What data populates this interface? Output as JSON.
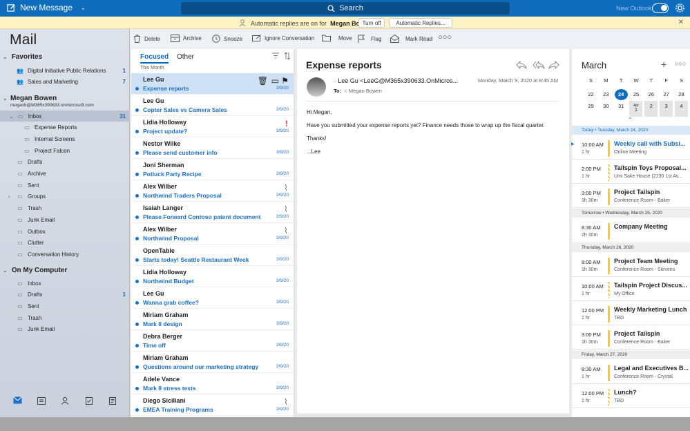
{
  "topbar": {
    "new_message": "New Message",
    "search": "Search",
    "new_outlook": "New Outlook"
  },
  "banner": {
    "text": "Automatic replies are on for",
    "user": "Megan Bowen.",
    "turn_off": "Turn off",
    "auto_replies": "Automatic Replies..."
  },
  "sidebar": {
    "title": "Mail",
    "favorites_label": "Favorites",
    "favorites": [
      {
        "label": "Digital Initiative Public Relations",
        "count": "1"
      },
      {
        "label": "Sales and Marketing",
        "count": "7"
      }
    ],
    "account_name": "Megan Bowen",
    "account_email": "meganb@M365x390633.onmicrosoft.com",
    "folders": [
      {
        "label": "Inbox",
        "count": "31"
      },
      {
        "label": "Expense Reports",
        "count": ""
      },
      {
        "label": "Internal Screens",
        "count": ""
      },
      {
        "label": "Project Falcon",
        "count": ""
      },
      {
        "label": "Drafts",
        "count": ""
      },
      {
        "label": "Archive",
        "count": ""
      },
      {
        "label": "Sent",
        "count": ""
      },
      {
        "label": "Groups",
        "count": ""
      },
      {
        "label": "Trash",
        "count": ""
      },
      {
        "label": "Junk Email",
        "count": ""
      },
      {
        "label": "Outbox",
        "count": ""
      },
      {
        "label": "Clutter",
        "count": ""
      },
      {
        "label": "Conversation History",
        "count": ""
      }
    ],
    "computer_label": "On My Computer",
    "computer_folders": [
      {
        "label": "Inbox",
        "count": ""
      },
      {
        "label": "Drafts",
        "count": "1"
      },
      {
        "label": "Sent",
        "count": ""
      },
      {
        "label": "Trash",
        "count": ""
      },
      {
        "label": "Junk Email",
        "count": ""
      }
    ]
  },
  "toolbar": {
    "delete": "Delete",
    "archive": "Archive",
    "snooze": "Snooze",
    "ignore": "Ignore Conversation",
    "move": "Move",
    "flag": "Flag",
    "mark_read": "Mark Read"
  },
  "list": {
    "tab_focused": "Focused",
    "tab_other": "Other",
    "this_month": "This Month",
    "messages": [
      {
        "sender": "Lee Gu",
        "subject": "Expense reports",
        "date": "3/9/20"
      },
      {
        "sender": "Lee Gu",
        "subject": "Copter Sales vs Camera Sales",
        "date": "3/9/20"
      },
      {
        "sender": "Lidia Holloway",
        "subject": "Project update?",
        "date": "3/9/20"
      },
      {
        "sender": "Nestor Wilke",
        "subject": "Please send customer info",
        "date": "3/9/20"
      },
      {
        "sender": "Joni Sherman",
        "subject": "Potluck Party Recipe",
        "date": "3/9/20"
      },
      {
        "sender": "Alex Wilber",
        "subject": "Northwind Traders Proposal",
        "date": "3/9/20"
      },
      {
        "sender": "Isaiah Langer",
        "subject": "Please Forward Contoso patent document",
        "date": "3/9/20"
      },
      {
        "sender": "Alex Wilber",
        "subject": "Northwind Proposal",
        "date": "3/9/20"
      },
      {
        "sender": "OpenTable",
        "subject": "Starts today! Seattle Restaurant Week",
        "date": "3/9/20"
      },
      {
        "sender": "Lidia Holloway",
        "subject": "Northwind Budget",
        "date": "3/9/20"
      },
      {
        "sender": "Lee Gu",
        "subject": "Wanna grab coffee?",
        "date": "3/9/20"
      },
      {
        "sender": "Miriam Graham",
        "subject": "Mark 8 design",
        "date": "3/9/20"
      },
      {
        "sender": "Debra Berger",
        "subject": "Time off",
        "date": "3/9/20"
      },
      {
        "sender": "Miriam Graham",
        "subject": "Questions around our marketing strategy",
        "date": "3/9/20"
      },
      {
        "sender": "Adele Vance",
        "subject": "Mark 8 stress tests",
        "date": "3/9/20"
      },
      {
        "sender": "Diego Siciliani",
        "subject": "EMEA Training Programs",
        "date": "3/9/20"
      }
    ]
  },
  "reading": {
    "subject": "Expense reports",
    "from": "Lee Gu <LeeG@M365x390633.OnMicros...",
    "to_label": "To:",
    "to": "Megan Bowen",
    "date": "Monday, March 9, 2020 at 8:45 AM",
    "body": [
      "Hi Megan,",
      "Have you submitted your expense reports yet?  Finance needs those to wrap up the fiscal quarter.",
      "Thanks!",
      "...Lee"
    ]
  },
  "calendar": {
    "month": "March",
    "days": [
      "S",
      "M",
      "T",
      "W",
      "T",
      "F",
      "S"
    ],
    "week1": [
      "22",
      "23",
      "24",
      "25",
      "26",
      "27",
      "28"
    ],
    "week2": [
      "29",
      "30",
      "31",
      "1",
      "2",
      "3",
      "4"
    ],
    "apr": "Apr",
    "sections": [
      {
        "label": "Today • Tuesday, March 24, 2020",
        "events": [
          {
            "time": "10:00 AM",
            "dur": "1 hr",
            "title": "Weekly call with Subsi...",
            "loc": "Online Meeting"
          },
          {
            "time": "2:00 PM",
            "dur": "1 hr",
            "title": "Tailspin Toys Proposal...",
            "loc": "Umi Sake House (2230 1st Av..."
          },
          {
            "time": "3:00 PM",
            "dur": "1h 30m",
            "title": "Project Tailspin",
            "loc": "Conference Room - Baker"
          }
        ]
      },
      {
        "label": "Tomorrow • Wednesday, March 25, 2020",
        "events": [
          {
            "time": "8:30 AM",
            "dur": "2h 30m",
            "title": "Company Meeting",
            "loc": ""
          }
        ]
      },
      {
        "label": "Thursday, March 26, 2020",
        "events": [
          {
            "time": "8:00 AM",
            "dur": "1h 30m",
            "title": "Project Team Meeting",
            "loc": "Conference Room - Stevens"
          },
          {
            "time": "10:00 AM",
            "dur": "1 hr",
            "title": "Tailspin Project Discus...",
            "loc": "My Office"
          },
          {
            "time": "12:00 PM",
            "dur": "1 hr",
            "title": "Weekly Marketing Lunch",
            "loc": "TBD"
          },
          {
            "time": "3:00 PM",
            "dur": "1h 30m",
            "title": "Project Tailspin",
            "loc": "Conference Room - Baker"
          }
        ]
      },
      {
        "label": "Friday, March 27, 2020",
        "events": [
          {
            "time": "8:30 AM",
            "dur": "1 hr",
            "title": "Legal and Executives B...",
            "loc": "Conference Room - Crystal"
          },
          {
            "time": "12:00 PM",
            "dur": "1 hr",
            "title": "Lunch?",
            "loc": "TBD"
          }
        ]
      }
    ]
  }
}
